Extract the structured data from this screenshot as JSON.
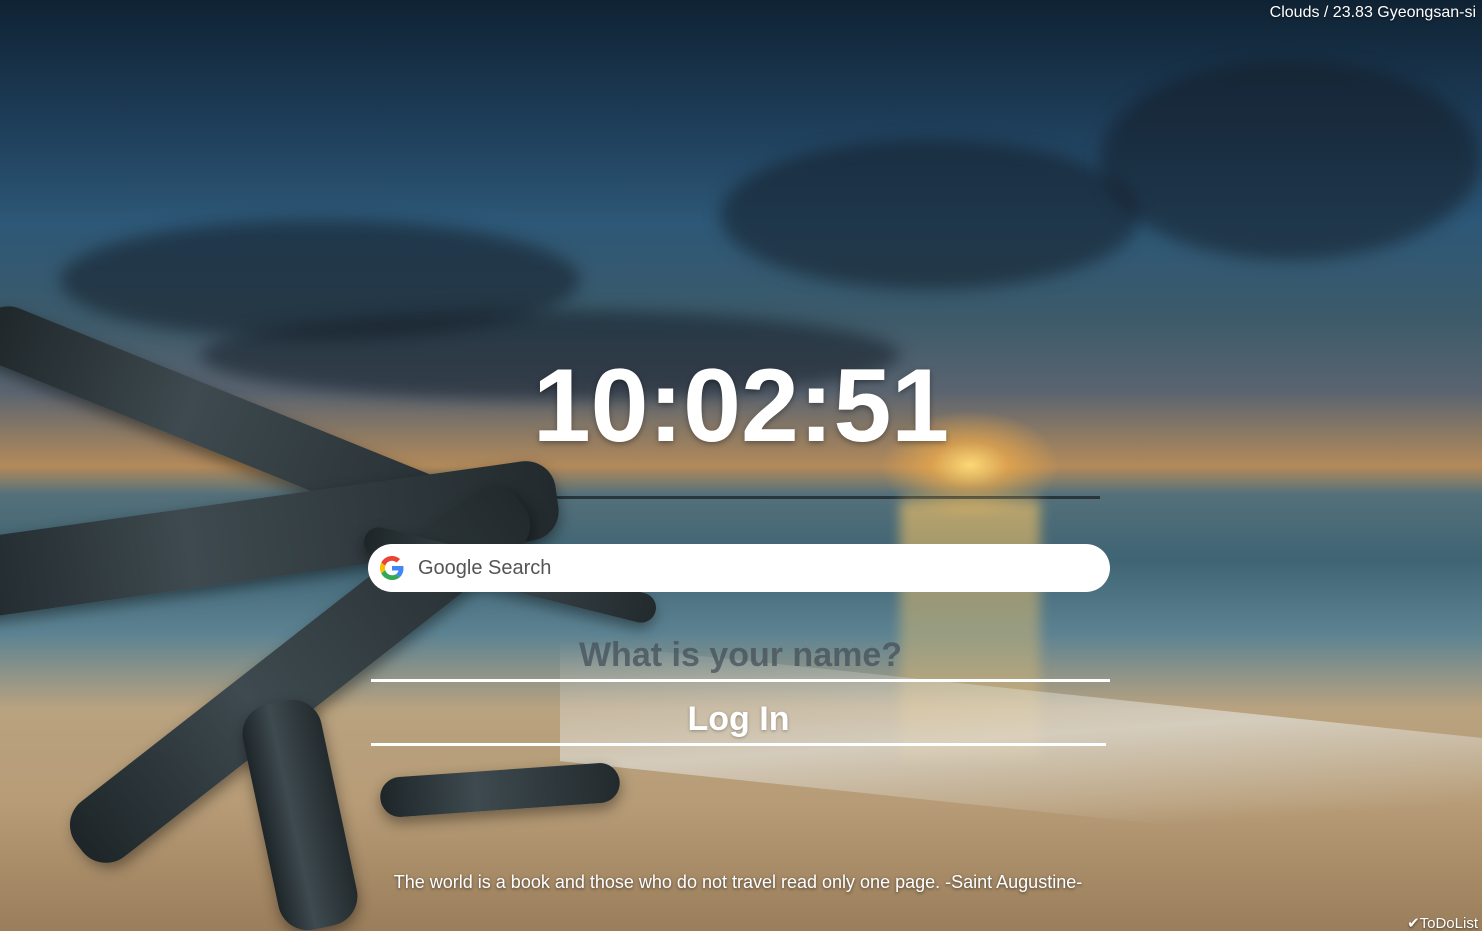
{
  "weather": {
    "text": "Clouds / 23.83 Gyeongsan-si"
  },
  "clock": {
    "time": "10:02:51"
  },
  "search": {
    "placeholder": "Google Search",
    "icon": "google-g-icon"
  },
  "login": {
    "name_placeholder": "What is your name?",
    "button_label": "Log In"
  },
  "quote": {
    "text": "The world is a book and those who do not travel read only one page. -Saint Augustine-"
  },
  "todo": {
    "label": "✔ToDoList"
  },
  "colors": {
    "text": "#ffffff",
    "search_bg": "#ffffff",
    "google_blue": "#4285F4",
    "google_red": "#EA4335",
    "google_yellow": "#FBBC05",
    "google_green": "#34A853"
  }
}
